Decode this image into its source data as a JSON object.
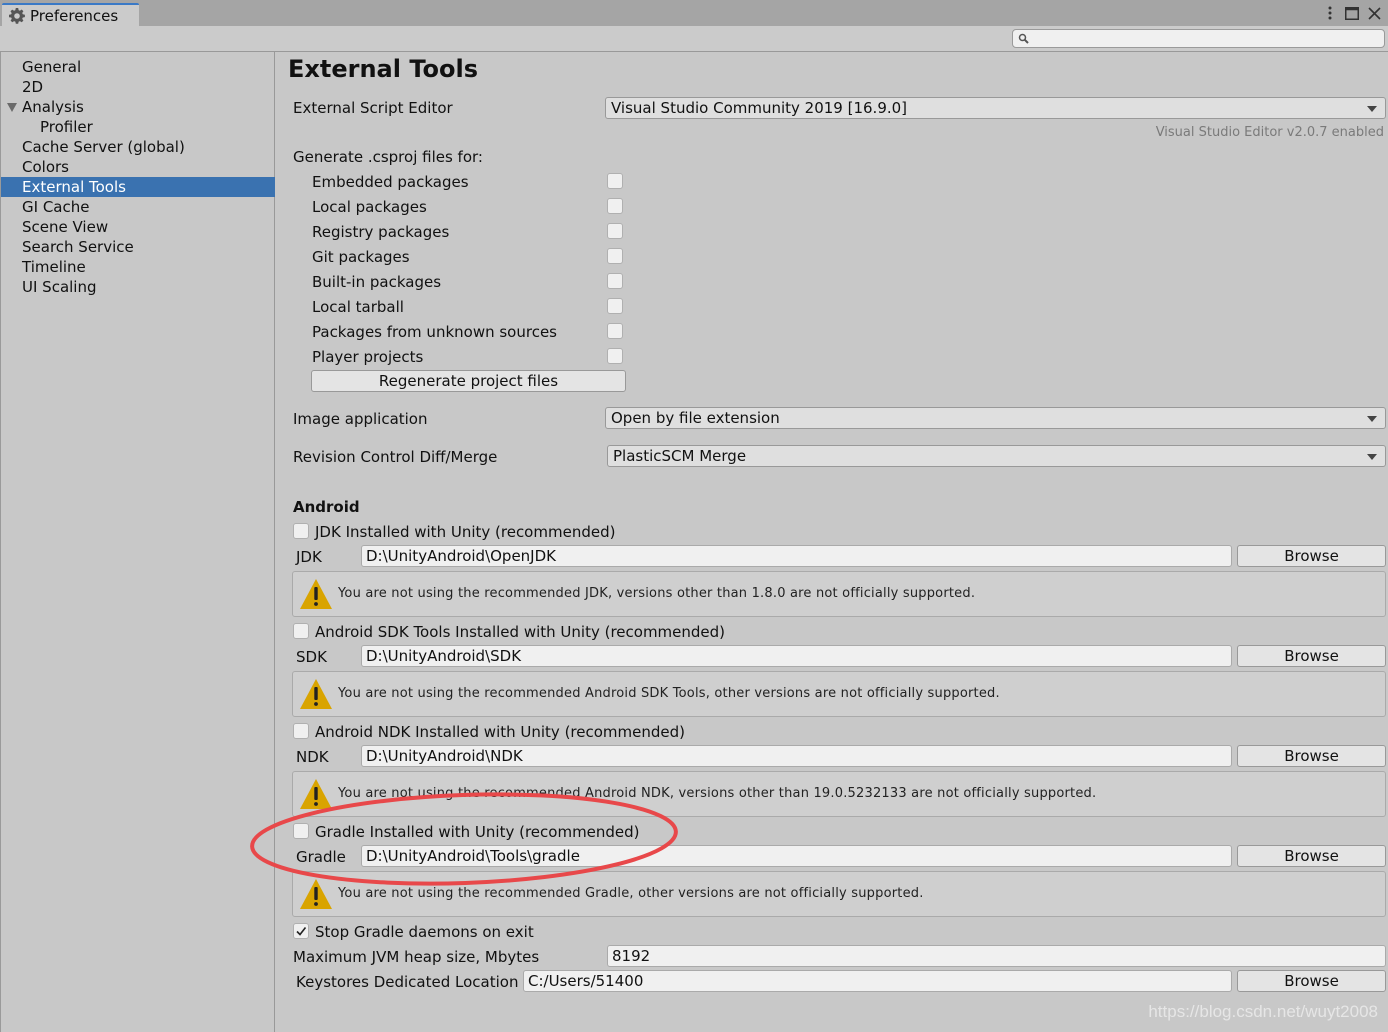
{
  "window": {
    "tab_title": "Preferences",
    "icons": {
      "tab": "gear-icon",
      "menu": "kebab-menu-icon",
      "maximize": "maximize-icon",
      "close": "close-icon",
      "search": "search-icon"
    },
    "search": {
      "value": "",
      "placeholder": ""
    }
  },
  "sidebar": {
    "items": [
      {
        "label": "General",
        "level": 0,
        "selected": false
      },
      {
        "label": "2D",
        "level": 0,
        "selected": false
      },
      {
        "label": "Analysis",
        "level": 0,
        "expanded": true,
        "selected": false
      },
      {
        "label": "Profiler",
        "level": 1,
        "selected": false
      },
      {
        "label": "Cache Server (global)",
        "level": 0,
        "selected": false
      },
      {
        "label": "Colors",
        "level": 0,
        "selected": false
      },
      {
        "label": "External Tools",
        "level": 0,
        "selected": true
      },
      {
        "label": "GI Cache",
        "level": 0,
        "selected": false
      },
      {
        "label": "Scene View",
        "level": 0,
        "selected": false
      },
      {
        "label": "Search Service",
        "level": 0,
        "selected": false
      },
      {
        "label": "Timeline",
        "level": 0,
        "selected": false
      },
      {
        "label": "UI Scaling",
        "level": 0,
        "selected": false
      }
    ]
  },
  "main": {
    "title": "External Tools",
    "script_editor": {
      "label": "External Script Editor",
      "value": "Visual Studio Community 2019 [16.9.0]",
      "hint": "Visual Studio Editor v2.0.7 enabled"
    },
    "csproj": {
      "heading": "Generate .csproj files for:",
      "options": [
        {
          "label": "Embedded packages",
          "checked": false
        },
        {
          "label": "Local packages",
          "checked": false
        },
        {
          "label": "Registry packages",
          "checked": false
        },
        {
          "label": "Git packages",
          "checked": false
        },
        {
          "label": "Built-in packages",
          "checked": false
        },
        {
          "label": "Local tarball",
          "checked": false
        },
        {
          "label": "Packages from unknown sources",
          "checked": false
        },
        {
          "label": "Player projects",
          "checked": false
        }
      ],
      "regenerate_label": "Regenerate project files"
    },
    "image_application": {
      "label": "Image application",
      "value": "Open by file extension"
    },
    "revision_control": {
      "label": "Revision Control Diff/Merge",
      "value": "PlasticSCM Merge"
    },
    "android": {
      "heading": "Android",
      "jdk": {
        "checkbox_label": "JDK Installed with Unity (recommended)",
        "checked": false,
        "field_label": "JDK",
        "path": "D:\\UnityAndroid\\OpenJDK",
        "browse": "Browse",
        "warning": "You are not using the recommended JDK, versions other than 1.8.0 are not officially supported."
      },
      "sdk": {
        "checkbox_label": "Android SDK Tools Installed with Unity (recommended)",
        "checked": false,
        "field_label": "SDK",
        "path": "D:\\UnityAndroid\\SDK",
        "browse": "Browse",
        "warning": "You are not using the recommended Android SDK Tools, other versions are not officially supported."
      },
      "ndk": {
        "checkbox_label": "Android NDK Installed with Unity (recommended)",
        "checked": false,
        "field_label": "NDK",
        "path": "D:\\UnityAndroid\\NDK",
        "browse": "Browse",
        "warning": "You are not using the recommended Android NDK, versions other than 19.0.5232133 are not officially supported."
      },
      "gradle": {
        "checkbox_label": "Gradle Installed with Unity (recommended)",
        "checked": false,
        "field_label": "Gradle",
        "path": "D:\\UnityAndroid\\Tools\\gradle",
        "browse": "Browse",
        "warning": "You are not using the recommended Gradle, other versions are not officially supported."
      },
      "stop_gradle": {
        "label": "Stop Gradle daemons on exit",
        "checked": true
      },
      "jvm_heap": {
        "label": "Maximum JVM heap size, Mbytes",
        "value": "8192"
      },
      "keystores": {
        "label": "Keystores Dedicated Location",
        "value": "C:/Users/51400",
        "browse": "Browse"
      }
    }
  },
  "overlay": {
    "annotation_color": "#e8484a",
    "watermark": "https://blog.csdn.net/wuyt2008"
  },
  "colors": {
    "accent": "#3a72b0",
    "tab_highlight": "#3a79c6",
    "warning": "#d9a400"
  }
}
